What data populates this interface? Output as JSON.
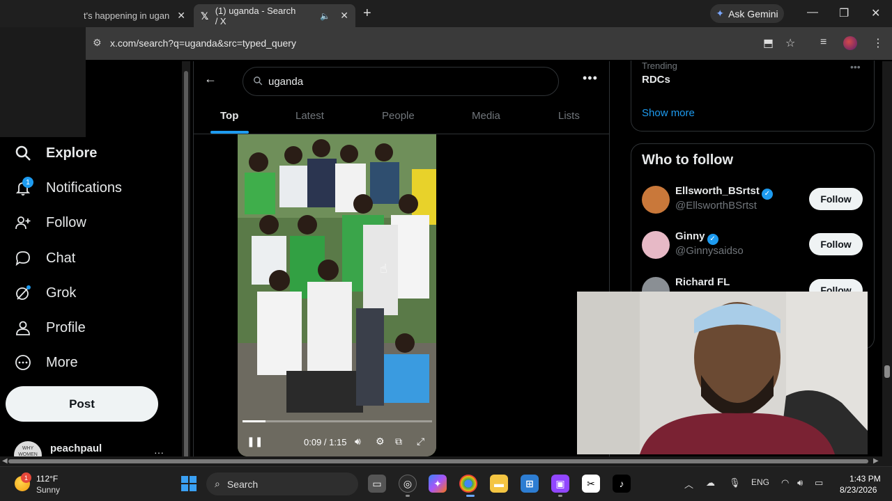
{
  "browser": {
    "tabs": [
      {
        "title": "t's happening in ugan",
        "active": false
      },
      {
        "title": "(1) uganda - Search / X",
        "active": true,
        "favicon": "x-logo-icon",
        "audio": true
      }
    ],
    "new_tab_glyph": "+",
    "gemini_label": "Ask Gemini",
    "url": "x.com/search?q=uganda&src=typed_query",
    "window_controls": [
      "minimize",
      "restore",
      "close"
    ]
  },
  "nav": {
    "items": [
      {
        "label": "Explore",
        "icon": "search-icon",
        "bold": true
      },
      {
        "label": "Notifications",
        "icon": "bell-icon",
        "badge": "1"
      },
      {
        "label": "Follow",
        "icon": "add-person-icon"
      },
      {
        "label": "Chat",
        "icon": "chat-bubble-icon"
      },
      {
        "label": "Grok",
        "icon": "grok-icon"
      },
      {
        "label": "Profile",
        "icon": "person-icon"
      },
      {
        "label": "More",
        "icon": "more-circle-icon"
      }
    ],
    "post_label": "Post",
    "user": {
      "name": "peachpaul",
      "avatar_text": "WHY WOMEN DESERVE"
    }
  },
  "search": {
    "query": "uganda",
    "tabs": [
      "Top",
      "Latest",
      "People",
      "Media",
      "Lists"
    ],
    "selected_tab": "Top"
  },
  "video": {
    "time": "0:09 / 1:15",
    "progress_fraction": 0.12
  },
  "trending": {
    "category": "Trending",
    "name": "RDCs",
    "show_more": "Show more"
  },
  "who_to_follow": {
    "title": "Who to follow",
    "accounts": [
      {
        "name": "Ellsworth_BSrtst",
        "handle": "@EllsworthBSrtst",
        "verified": true,
        "button": "Follow",
        "avatar_color": "#c9783a"
      },
      {
        "name": "Ginny",
        "handle": "@Ginnysaidso",
        "verified": true,
        "button": "Follow",
        "avatar_color": "#e7b9c6"
      },
      {
        "name": "Richard FL",
        "handle": "",
        "verified": false,
        "button": "Follow",
        "avatar_color": "#8a8f94"
      }
    ]
  },
  "taskbar": {
    "weather": {
      "temp": "112°F",
      "condition": "Sunny",
      "badge": "1"
    },
    "search_label": "Search",
    "language": "ENG",
    "time": "1:43 PM",
    "date": "8/23/2026"
  },
  "colors": {
    "accent": "#1d9bf0",
    "background": "#000000",
    "border": "#2f3336"
  }
}
